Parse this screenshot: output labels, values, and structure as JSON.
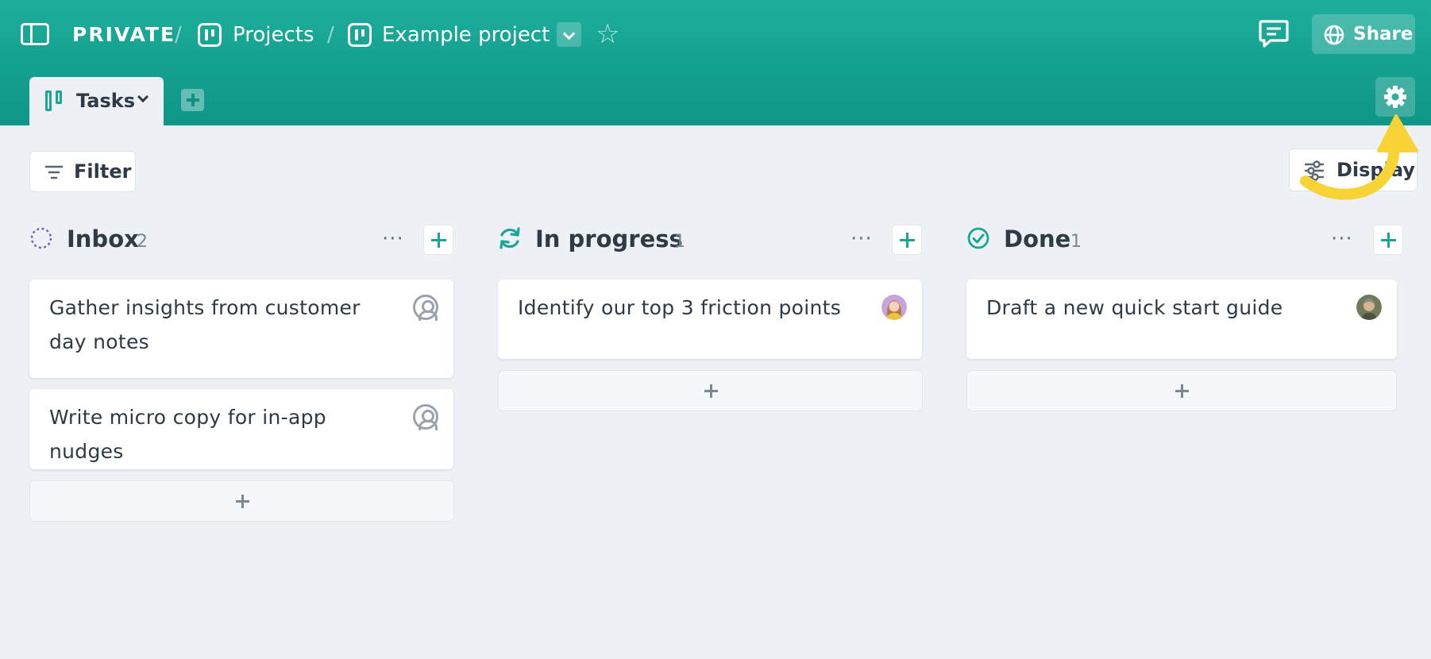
{
  "header": {
    "breadcrumb": {
      "workspace": "PRIVATE",
      "separator": "/",
      "section": "Projects",
      "project": "Example project"
    },
    "share_label": "Share",
    "accent_color": "#17a594"
  },
  "tabs": {
    "active_label": "Tasks"
  },
  "toolbar": {
    "filter_label": "Filter",
    "display_label": "Display"
  },
  "annotation": {
    "arrow_color": "#f7d335"
  },
  "columns": [
    {
      "title": "Inbox",
      "count": "2",
      "more": "···",
      "cards": [
        {
          "text": "Gather insights from customer day notes",
          "assignee": "unassigned-icon"
        },
        {
          "text": "Write micro copy for in-app nudges",
          "assignee": "unassigned-icon"
        }
      ]
    },
    {
      "title": "In progress",
      "count": "1",
      "more": "···",
      "cards": [
        {
          "text": "Identify our top 3 friction points",
          "assignee": "avatar-woman"
        }
      ]
    },
    {
      "title": "Done",
      "count": "1",
      "more": "···",
      "cards": [
        {
          "text": "Draft a new quick start guide",
          "assignee": "avatar-man"
        }
      ]
    }
  ]
}
